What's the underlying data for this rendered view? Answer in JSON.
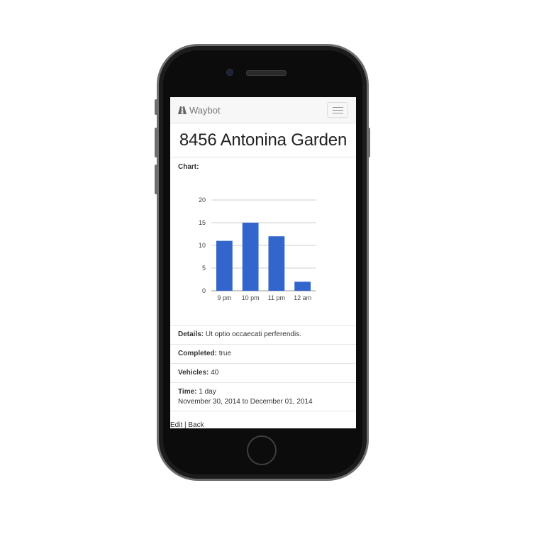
{
  "navbar": {
    "brand": "Waybot"
  },
  "page": {
    "title": "8456 Antonina Garden"
  },
  "chart_section": {
    "label": "Chart:"
  },
  "chart_data": {
    "type": "bar",
    "categories": [
      "9 pm",
      "10 pm",
      "11 pm",
      "12 am"
    ],
    "values": [
      11,
      15,
      12,
      2
    ],
    "ylim": [
      0,
      20
    ],
    "yticks": [
      0,
      5,
      10,
      15,
      20
    ],
    "bar_color": "#3366cc",
    "grid": true
  },
  "details": {
    "label": "Details:",
    "value": "Ut optio occaecati perferendis."
  },
  "completed": {
    "label": "Completed:",
    "value": "true"
  },
  "vehicles": {
    "label": "Vehicles:",
    "value": "40"
  },
  "time": {
    "label": "Time:",
    "value": "1 day",
    "range": "November 30, 2014 to December 01, 2014"
  },
  "footer": {
    "edit": "Edit",
    "separator": " | ",
    "back": "Back"
  }
}
